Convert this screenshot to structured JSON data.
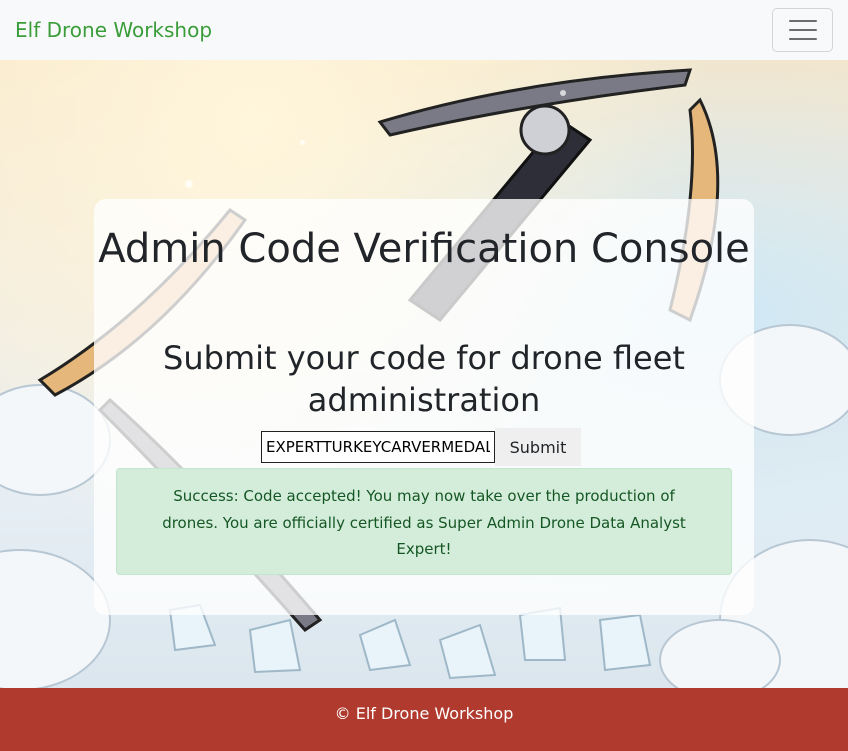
{
  "navbar": {
    "brand": "Elf Drone Workshop",
    "toggle_icon": "hamburger-icon",
    "brand_color": "#3a9d3a"
  },
  "main": {
    "title": "Admin Code Verification Console",
    "subtitle": "Submit your code for drone fleet administration",
    "code_input_value": "EXPERTTURKEYCARVERMEDAL",
    "submit_label": "Submit",
    "alert_message": "Success: Code accepted! You may now take over the production of drones. You are officially certified as Super Admin Drone Data Analyst Expert!"
  },
  "footer": {
    "text": "© Elf Drone Workshop",
    "background": "#b03a2e"
  }
}
